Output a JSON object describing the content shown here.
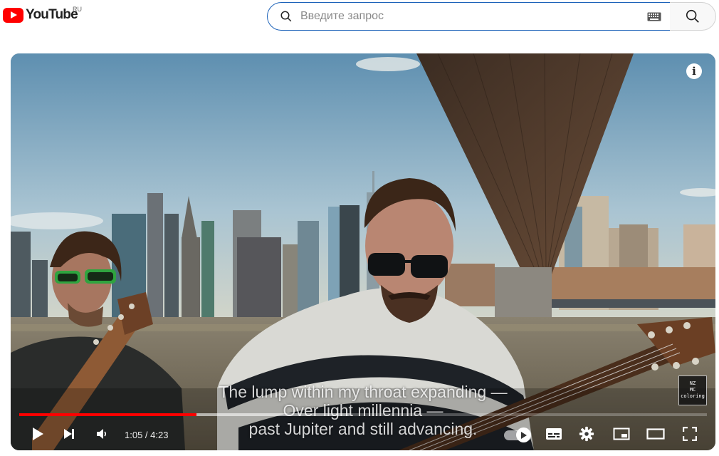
{
  "header": {
    "logo_text": "YouTube",
    "country_code": "RU",
    "search": {
      "placeholder": "Введите запрос",
      "value": ""
    }
  },
  "player": {
    "captions": [
      "The lump within my throat expanding —",
      "Over light millennia —",
      "past Jupiter and still advancing."
    ],
    "info_symbol": "i",
    "watermark": {
      "lines": [
        "NZ",
        "MC",
        "coloring"
      ]
    },
    "progress": {
      "played_fraction": 0.258,
      "buffered_fraction": 0.48
    },
    "time": {
      "current": "1:05",
      "separator": " / ",
      "duration": "4:23"
    },
    "autoplay_on": true,
    "colors": {
      "progress_played": "#ff0000",
      "logo_red": "#ff0000",
      "search_border": "#1c62b9"
    }
  },
  "icons": {
    "play": "play-icon",
    "next": "next-icon",
    "volume": "volume-icon",
    "subtitles": "subtitles-icon",
    "settings": "gear-icon",
    "miniplayer": "miniplayer-icon",
    "theater": "theater-icon",
    "fullscreen": "fullscreen-icon",
    "search": "search-icon",
    "keyboard": "keyboard-icon"
  }
}
